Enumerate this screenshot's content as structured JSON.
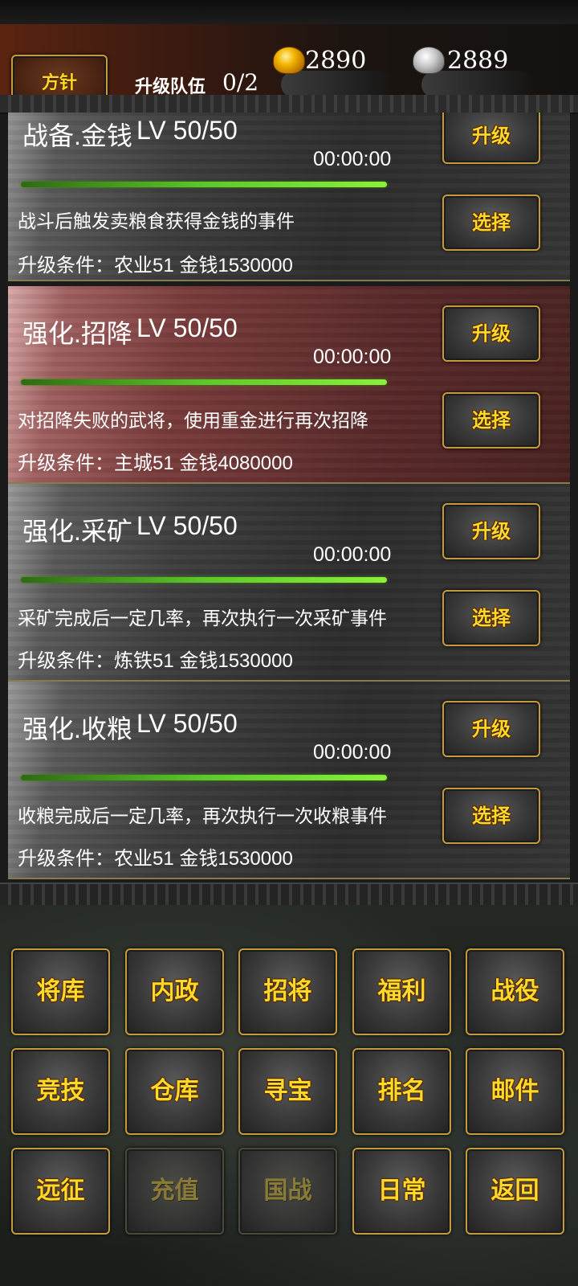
{
  "header": {
    "policy_button": "方针",
    "queue_label": "升级队伍",
    "queue_value": "0/2",
    "gold_value": "2890",
    "silver_value": "2889",
    "gold_icon": "gold-ingot-icon",
    "silver_icon": "silver-ingot-icon"
  },
  "cards": [
    {
      "title": "战备.金钱",
      "level": "LV 50/50",
      "timer": "00:00:00",
      "progress": 1.0,
      "desc": "战斗后触发卖粮食获得金钱的事件",
      "req": "升级条件：农业51 金钱1530000",
      "upgrade_label": "升级",
      "select_label": "选择",
      "selected": false
    },
    {
      "title": "强化.招降",
      "level": "LV 50/50",
      "timer": "00:00:00",
      "progress": 1.0,
      "desc": "对招降失败的武将，使用重金进行再次招降",
      "req": "升级条件：主城51 金钱4080000",
      "upgrade_label": "升级",
      "select_label": "选择",
      "selected": true
    },
    {
      "title": "强化.采矿",
      "level": "LV 50/50",
      "timer": "00:00:00",
      "progress": 1.0,
      "desc": "采矿完成后一定几率，再次执行一次采矿事件",
      "req": "升级条件：炼铁51 金钱1530000",
      "upgrade_label": "升级",
      "select_label": "选择",
      "selected": false
    },
    {
      "title": "强化.收粮",
      "level": "LV 50/50",
      "timer": "00:00:00",
      "progress": 1.0,
      "desc": "收粮完成后一定几率，再次执行一次收粮事件",
      "req": "升级条件：农业51 金钱1530000",
      "upgrade_label": "升级",
      "select_label": "选择",
      "selected": false
    }
  ],
  "menu": [
    [
      "将库",
      "内政",
      "招将",
      "福利",
      "战役"
    ],
    [
      "竞技",
      "仓库",
      "寻宝",
      "排名",
      "邮件"
    ],
    [
      "远征",
      "充值",
      "国战",
      "日常",
      "返回"
    ]
  ],
  "menu_disabled": [
    "充值",
    "国战"
  ],
  "colors": {
    "button_text": "#ffd92a",
    "button_border": "#c59a3c",
    "progress_green": "#5cc82a",
    "selected_card": "#7a3c3c"
  }
}
